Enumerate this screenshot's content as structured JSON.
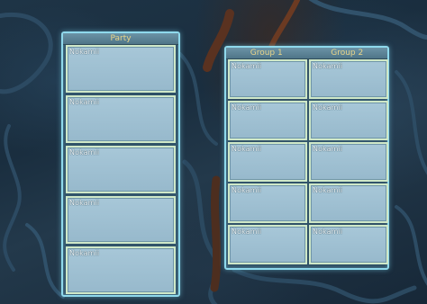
{
  "party": {
    "title": "Party",
    "members": [
      {
        "name": "Nokamii"
      },
      {
        "name": "Nokamii"
      },
      {
        "name": "Nokamii"
      },
      {
        "name": "Nokamii"
      },
      {
        "name": "Nokamii"
      }
    ]
  },
  "raid": {
    "groups": [
      {
        "title": "Group 1",
        "members": [
          {
            "name": "Nokamii"
          },
          {
            "name": "Nokamii"
          },
          {
            "name": "Nokamii"
          },
          {
            "name": "Nokamii"
          },
          {
            "name": "Nokamii"
          }
        ]
      },
      {
        "title": "Group 2",
        "members": [
          {
            "name": "Nokamii"
          },
          {
            "name": "Nokamii"
          },
          {
            "name": "Nokamii"
          },
          {
            "name": "Nokamii"
          },
          {
            "name": "Nokamii"
          }
        ]
      }
    ]
  },
  "colors": {
    "panel_border": "#8fd9ec",
    "frame_border": "#cfe8c8",
    "frame_fill": "#a7c7d8",
    "header_text": "#e9d58a",
    "name_text": "#eef5f8"
  }
}
